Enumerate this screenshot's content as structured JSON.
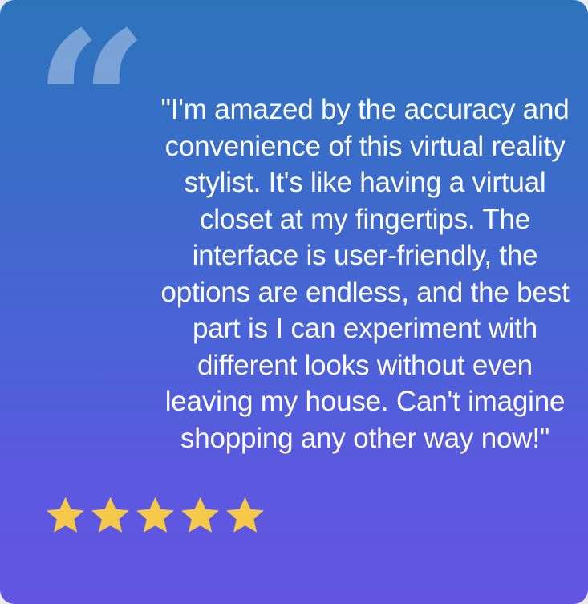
{
  "testimonial": {
    "quote": "\"I'm amazed by the accuracy and convenience of this virtual reality stylist. It's like having a virtual closet at my fingertips. The interface is user-friendly, the options are endless, and the best part is I can experiment with different looks without even leaving my house. Can't imagine shopping any other way now!\"",
    "quote_mark_glyph": "“",
    "rating": 5,
    "rating_max": 5
  },
  "colors": {
    "gradient_top": "#2c74ba",
    "gradient_bottom": "#6355e0",
    "star": "#f6c84a",
    "text": "#ffffff"
  },
  "icons": {
    "quote": "quote-mark-icon",
    "star": "star-icon"
  }
}
